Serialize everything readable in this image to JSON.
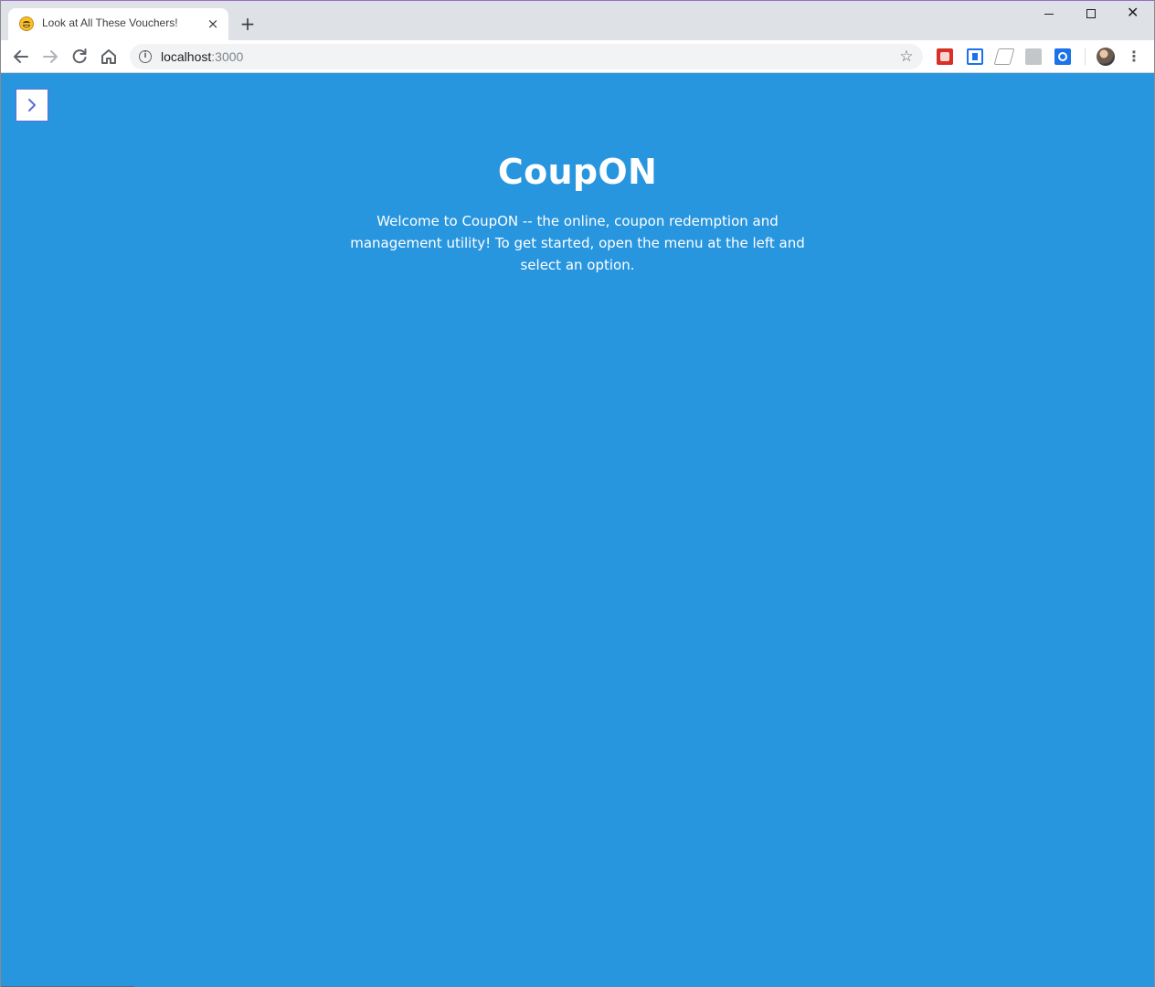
{
  "browser": {
    "tab": {
      "title": "Look at All These Vouchers!",
      "close_label": "×"
    },
    "new_tab_label": "+",
    "address": {
      "host": "localhost",
      "port": ":3000"
    }
  },
  "page": {
    "title": "CoupON",
    "welcome": "Welcome to CoupON -- the online, coupon redemption and management utility! To get started, open the menu at the left and select an option."
  },
  "colors": {
    "page_background": "#2896df",
    "menu_toggle_border": "#5a6fd6",
    "menu_toggle_chevron": "#5a6fd6"
  },
  "icons": [
    "favicon-smiley-icon",
    "tab-close-icon",
    "new-tab-icon",
    "minimize-icon",
    "maximize-icon",
    "close-window-icon",
    "back-arrow-icon",
    "forward-arrow-icon",
    "reload-icon",
    "home-icon",
    "info-icon",
    "bookmark-star-icon",
    "chevron-right-icon",
    "menu-kebab-icon"
  ]
}
